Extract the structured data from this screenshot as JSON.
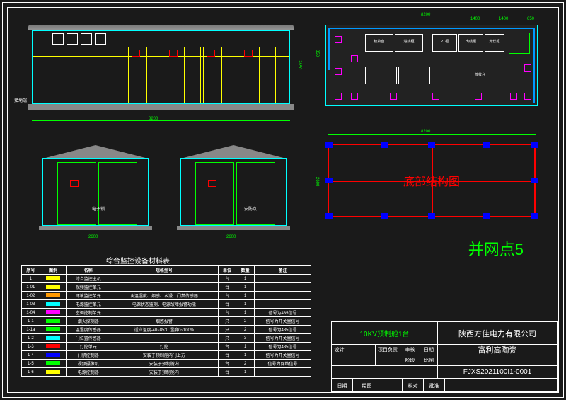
{
  "drawing_number": "FJXS2021100I1-0001",
  "company": "陕西方佳电力有限公司",
  "project": "富利高陶瓷",
  "equipment": "10KV预制舱1台",
  "node_name": "并网点5",
  "bottom_structure_label": "底部结构图",
  "table_title": "综合监控设备材料表",
  "overall_width": "8200",
  "overall_height": "2850",
  "side_width": "2600",
  "plan_dims": {
    "w1": "8200",
    "s1": "1400",
    "s2": "1400",
    "s3": "650",
    "d": "850"
  },
  "table_headers": [
    "序号",
    "图例",
    "名称",
    "规格型号",
    "单位",
    "数量",
    "备注"
  ],
  "table_rows": [
    {
      "n": "1",
      "sym": "#ff0",
      "name": "综合监控主机",
      "spec": "",
      "u": "台",
      "q": "1",
      "r": ""
    },
    {
      "n": "1-01",
      "sym": "#ff0",
      "name": "视频监控单元",
      "spec": "",
      "u": "台",
      "q": "1",
      "r": ""
    },
    {
      "n": "1-02",
      "sym": "#f90",
      "name": "环境监控单元",
      "spec": "含温湿度、烟感、水浸、门禁传感器",
      "u": "台",
      "q": "1",
      "r": ""
    },
    {
      "n": "1-03",
      "sym": "#0ff",
      "name": "电源监控单元",
      "spec": "电源状态监测、电源故障报警功能",
      "u": "台",
      "q": "1",
      "r": ""
    },
    {
      "n": "1-04",
      "sym": "#f0f",
      "name": "空调控制单元",
      "spec": "",
      "u": "台",
      "q": "1",
      "r": "信号为485信号"
    },
    {
      "n": "1-1",
      "sym": "#0f0",
      "name": "烟火探测器",
      "spec": "烟感报警",
      "u": "只",
      "q": "2",
      "r": "信号为开关量信号"
    },
    {
      "n": "1-1a",
      "sym": "#0f0",
      "name": "温湿度传感器",
      "spec": "适应温度-40~85℃ 湿度0~100%",
      "u": "只",
      "q": "2",
      "r": "信号为485信号"
    },
    {
      "n": "1-2",
      "sym": "#0ff",
      "name": "门位置传感器",
      "spec": "",
      "u": "只",
      "q": "3",
      "r": "信号为开关量信号"
    },
    {
      "n": "1-3",
      "sym": "#f00",
      "name": "灯控单元",
      "spec": "灯控",
      "u": "台",
      "q": "1",
      "r": "信号为485信号"
    },
    {
      "n": "1-4",
      "sym": "#00f",
      "name": "门禁控制器",
      "spec": "安装于预制舱内门上方",
      "u": "台",
      "q": "1",
      "r": "信号为开关量信号"
    },
    {
      "n": "1-5",
      "sym": "#0f0",
      "name": "视频摄像机",
      "spec": "安装于预制舱内",
      "u": "台",
      "q": "2",
      "r": "信号为网络信号"
    },
    {
      "n": "1-6",
      "sym": "#ff0",
      "name": "电源控制器",
      "spec": "安装于预制舱内",
      "u": "台",
      "q": "1",
      "r": ""
    }
  ],
  "title_block_labels": {
    "design": "设计",
    "proj_mgr": "项目负责",
    "review": "审核",
    "date": "日期",
    "stage": "阶段",
    "scale": "比例",
    "drawn": "绘图",
    "check": "校对",
    "appr": "批准"
  },
  "plan_labels": [
    "梳妆台",
    "进线柜",
    "PT柜",
    "出线柜",
    "光伏柜"
  ],
  "leaders": {
    "gnd": "接地端",
    "sfd": "安防点",
    "dz": "电子锁"
  }
}
